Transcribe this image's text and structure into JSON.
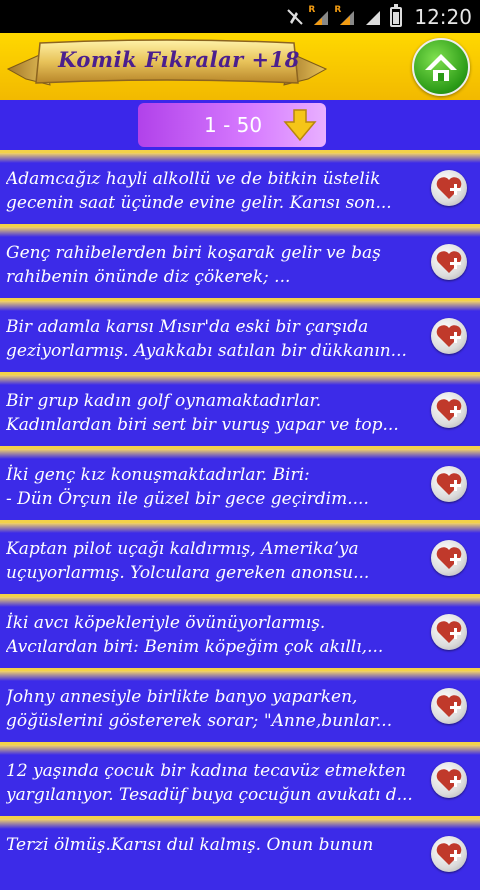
{
  "status_bar": {
    "time": "12:20",
    "icons": [
      "mute-icon",
      "signal-r-icon",
      "signal-r-icon",
      "signal-full-icon",
      "battery-icon"
    ],
    "roaming_label": "R"
  },
  "header": {
    "title": "Komik Fıkralar +18",
    "home_icon": "home-icon"
  },
  "pager": {
    "label": "1 - 50",
    "arrow_icon": "arrow-down-icon"
  },
  "items": [
    {
      "text": "Adamcağız hayli alkollü ve de bitkin üstelik\ngecenin saat üçünde evine gelir. Karısı son..."
    },
    {
      "text": "Genç rahibelerden biri koşarak gelir ve baş\nrahibenin önünde diz çökerek; ..."
    },
    {
      "text": "Bir adamla karısı Mısır'da eski bir çarşıda\ngeziyorlarmış. Ayakkabı satılan bir dükkanın..."
    },
    {
      "text": "Bir grup kadın golf oynamaktadırlar.\nKadınlardan biri sert bir vuruş yapar ve top..."
    },
    {
      "text": "İki genç kız konuşmaktadırlar. Biri:\n- Dün Örçun ile güzel bir gece geçirdim...."
    },
    {
      "text": "Kaptan pilot uçağı kaldırmış, Amerika’ya\nuçuyorlarmış. Yolculara gereken anonsu..."
    },
    {
      "text": "İki avcı köpekleriyle övünüyorlarmış.\nAvcılardan biri: Benim köpeğim çok akıllı,..."
    },
    {
      "text": "Johny annesiyle birlikte banyo yaparken,\ngöğüslerini göstererek sorar; \"Anne,bunlar..."
    },
    {
      "text": "12 yaşında çocuk bir kadına tecavüz etmekten\nyargılanıyor. Tesadüf buya çocuğun avukatı d..."
    },
    {
      "text": "Terzi ölmüş.Karısı dul kalmış. Onun bunun\n"
    }
  ],
  "colors": {
    "header_bg": "#f2c200",
    "list_bg": "#3c2be8",
    "separator": "#f3d24a",
    "title_color": "#4b1f8e",
    "page_selector": "#c05cf0"
  }
}
